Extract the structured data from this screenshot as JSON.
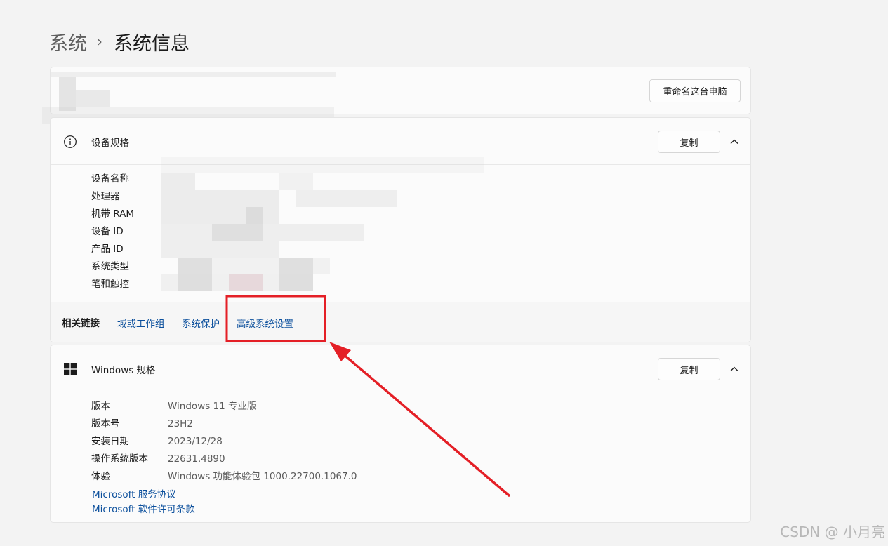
{
  "breadcrumb": {
    "parent": "系统",
    "separator": "›",
    "current": "系统信息"
  },
  "rename_card": {
    "button_label": "重命名这台电脑"
  },
  "device_specs": {
    "icon": "info-icon",
    "title": "设备规格",
    "copy_label": "复制",
    "collapse_icon": "chevron-up-icon",
    "rows": [
      {
        "label": "设备名称"
      },
      {
        "label": "处理器"
      },
      {
        "label": "机带 RAM"
      },
      {
        "label": "设备 ID"
      },
      {
        "label": "产品 ID"
      },
      {
        "label": "系统类型"
      },
      {
        "label": "笔和触控"
      }
    ]
  },
  "related_links": {
    "title": "相关链接",
    "links": [
      "域或工作组",
      "系统保护",
      "高级系统设置"
    ]
  },
  "windows_specs": {
    "icon": "windows-logo-icon",
    "title": "Windows 规格",
    "copy_label": "复制",
    "collapse_icon": "chevron-up-icon",
    "rows": [
      {
        "label": "版本",
        "value": "Windows 11 专业版"
      },
      {
        "label": "版本号",
        "value": "23H2"
      },
      {
        "label": "安装日期",
        "value": "2023/12/28"
      },
      {
        "label": "操作系统版本",
        "value": "22631.4890"
      },
      {
        "label": "体验",
        "value": "Windows 功能体验包 1000.22700.1067.0"
      }
    ],
    "links": [
      "Microsoft 服务协议",
      "Microsoft 软件许可条款"
    ]
  },
  "annotation": {
    "highlight_color": "#e41f26"
  },
  "watermark": "CSDN @  小月亮"
}
